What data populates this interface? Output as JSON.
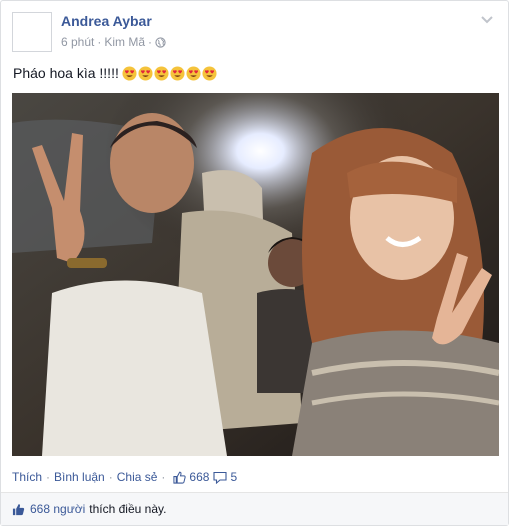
{
  "post": {
    "author": "Andrea Aybar",
    "time": "6 phút",
    "location": "Kim Mã",
    "caption": "Pháo hoa kìa !!!!!",
    "emoji_count": 6
  },
  "actions": {
    "like": "Thích",
    "comment": "Bình luận",
    "share": "Chia sẻ",
    "like_count": "668",
    "comment_count": "5"
  },
  "likes_summary": {
    "people": "668 người",
    "suffix": "thích điều này."
  },
  "colors": {
    "link": "#3b5998",
    "meta": "#9197a3",
    "text": "#141823"
  }
}
